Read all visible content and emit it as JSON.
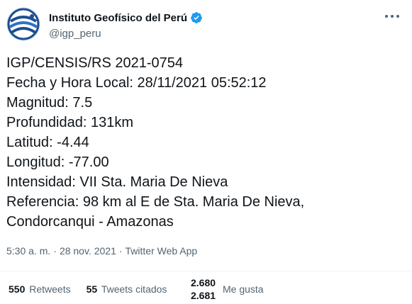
{
  "account": {
    "display_name": "Instituto Geofísico del Perú",
    "handle": "@igp_peru",
    "verified": true,
    "avatar_icon": "igp-logo-icon",
    "brand_color": "#1d4e8f"
  },
  "tweet": {
    "lines": [
      "IGP/CENSIS/RS 2021-0754",
      "Fecha y Hora Local: 28/11/2021 05:52:12",
      "Magnitud: 7.5",
      "Profundidad: 131km",
      "Latitud: -4.44",
      "Longitud: -77.00",
      "Intensidad: VII Sta. Maria De Nieva",
      "Referencia: 98 km al E de Sta. Maria De Nieva,",
      "Condorcanqui - Amazonas"
    ]
  },
  "meta": {
    "time": "5:30 a. m.",
    "separator": "·",
    "date": "28 nov. 2021",
    "source": "Twitter Web App"
  },
  "stats": {
    "retweets_count": "550",
    "retweets_label": "Retweets",
    "quotes_count": "55",
    "quotes_label": "Tweets citados",
    "likes_count_old": "2.680",
    "likes_count_new": "2.681",
    "likes_label": "Me gusta"
  },
  "colors": {
    "verified_badge": "#1d9bf0",
    "secondary_text": "#536471",
    "primary_text": "#0f1419"
  }
}
